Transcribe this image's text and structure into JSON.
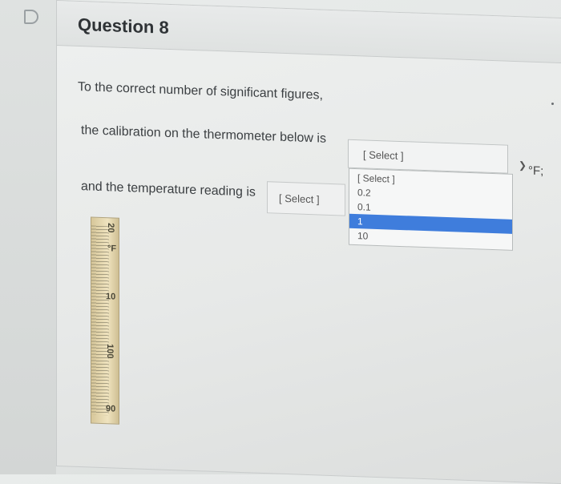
{
  "question": {
    "title": "Question 8",
    "line1": "To the correct number of significant figures,",
    "line2": "the calibration on the thermometer below is",
    "line3": "and the temperature reading is",
    "unit": "°F;"
  },
  "calibration_select": {
    "value": "[ Select ]",
    "options": [
      "[ Select ]",
      "0.2",
      "0.1",
      "1",
      "10"
    ],
    "highlighted": "1"
  },
  "reading_select": {
    "value": "[ Select ]"
  },
  "thermometer": {
    "labels": [
      "20",
      "°F",
      "10",
      "100",
      "90"
    ]
  }
}
